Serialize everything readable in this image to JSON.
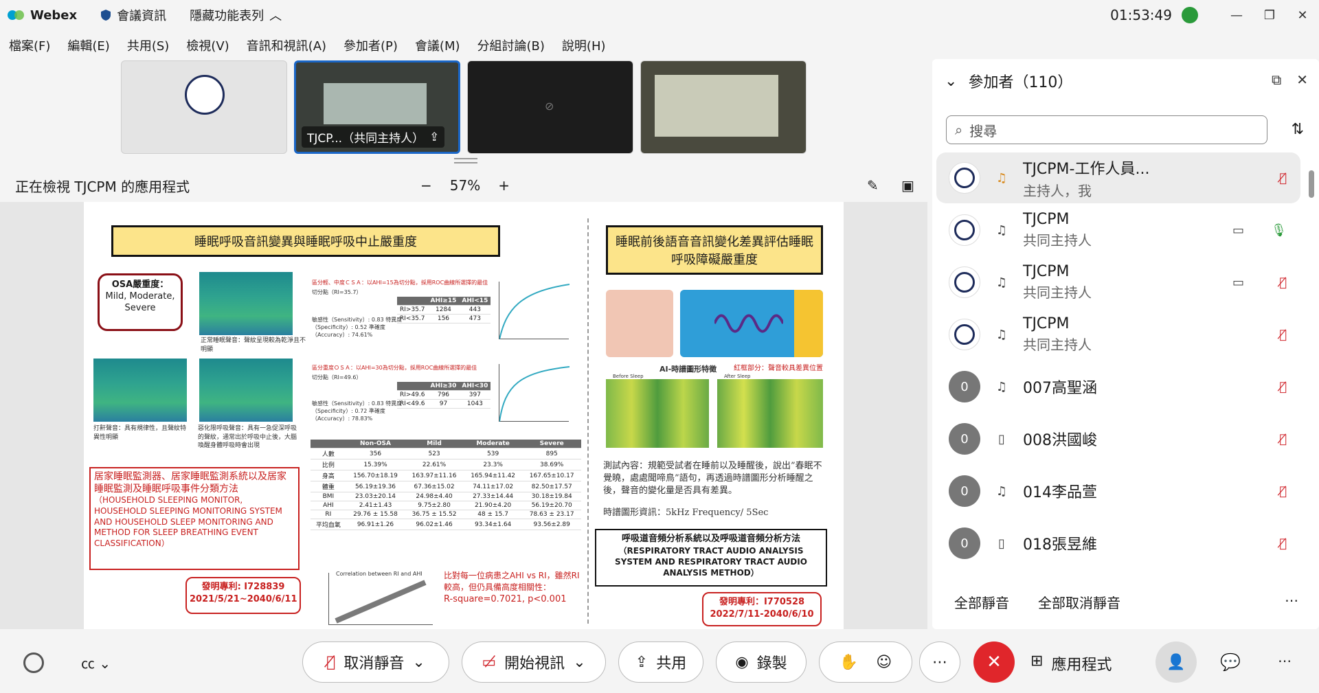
{
  "titlebar": {
    "app_name": "Webex",
    "meeting_info": "會議資訊",
    "hidden_features": "隱藏功能表列",
    "time": "01:53:49"
  },
  "menu": [
    "檔案(F)",
    "編輯(E)",
    "共用(S)",
    "檢視(V)",
    "音訊和視訊(A)",
    "參加者(P)",
    "會議(M)",
    "分組討論(B)",
    "說明(H)"
  ],
  "thumbnails": [
    {
      "label": ""
    },
    {
      "label": "TJCP...（共同主持人）"
    },
    {
      "label": ""
    },
    {
      "label": ""
    }
  ],
  "view": {
    "title": "正在檢視 TJCPM 的應用程式",
    "zoom": "57%"
  },
  "poster": {
    "left_title": "睡眠呼吸音訊變異與睡眠呼吸中止嚴重度",
    "right_title": "睡眠前後語音音訊變化差異評估睡眠呼吸障礙嚴重度",
    "osa_label": "OSA嚴重度：",
    "osa_levels": "Mild, Moderate, Severe",
    "normal_caption": "正常睡眠聲音：聲紋呈現較為乾淨且不明顯",
    "snore_caption": "打鼾聲音：具有規律性，且聲紋特異性明顯",
    "apnea_caption": "惡化限呼吸聲音：具有一急促深呼吸的聲紋，通常出於呼吸中止後，大腦喚醒身體呼吸時會出現",
    "invention_cn": "居家睡眠監測器、居家睡眠監測系統以及居家睡眠監測及睡眠呼吸事件分類方法",
    "invention_en": "（HOUSEHOLD SLEEPING MONITOR, HOUSEHOLD SLEEPING MONITORING SYSTEM AND HOUSEHOLD SLEEP MONITORING AND METHOD FOR SLEEP BREATHING EVENT CLASSIFICATION）",
    "patent1_no": "發明專利: I728839",
    "patent1_date": "2021/5/21~2040/6/11",
    "cut1_title": "區分輕、中度ＣＳＡ：以AHI=15為切分點，採用ROC曲線所選擇的最佳",
    "cut1_point": "切分點（RI=35.7）",
    "cut1_stats": "敏感性（Sensitivity）: 0.83  特異度（Specificity）: 0.52  準確度（Accuracy）: 74.61%",
    "cut2_title": "區分重度ＯＳＡ：以AHI=30為切分點，採用ROC曲線所選擇的最佳",
    "cut2_point": "切分點（RI=49.6）",
    "cut2_stats": "敏感性（Sensitivity）: 0.83  特異度（Specificity）: 0.72  準確度（Accuracy）: 78.83%",
    "compare_text": "比對每一位病患之AHI vs RI，雖然RI較高，但仍具備高度相關性：",
    "rsquare": "R-square=0.7021, p<0.001",
    "scatter_title": "Correlation between RI and AHI",
    "ai_title": "AI-時譜圖形特徵",
    "ai_red": "紅框部分：聲音較具差異位置",
    "before_sleep": "Before Sleep",
    "after_sleep": "After Sleep",
    "test_content": "測試內容：規範受試者在睡前以及睡醒後，說出”春眠不覺曉，處處聞啼鳥”語句，再透過時譜圖形分析睡醒之後，聲音的變化量是否具有差異。",
    "spectro_info": "時譜圖形資訊：5kHz Frequency/ 5Sec",
    "method_cn": "呼吸道音頻分析系統以及呼吸道音頻分析方法",
    "method_en": "（RESPIRATORY TRACT AUDIO ANALYSIS SYSTEM AND RESPIRATORY TRACT AUDIO ANALYSIS METHOD）",
    "patent2_no": "發明專利：I770528",
    "patent2_date": "2022/7/11-2040/6/10",
    "stats_headers": [
      "",
      "Non-OSA",
      "Mild",
      "Moderate",
      "Severe"
    ],
    "stats_rows": [
      [
        "人數",
        "356",
        "523",
        "539",
        "895"
      ],
      [
        "比例",
        "15.39%",
        "22.61%",
        "23.3%",
        "38.69%"
      ],
      [
        "身高",
        "156.70±18.19",
        "163.97±11.16",
        "165.94±11.42",
        "167.65±10.17"
      ],
      [
        "體重",
        "56.19±19.36",
        "67.36±15.02",
        "74.11±17.02",
        "82.50±17.57"
      ],
      [
        "BMI",
        "23.03±20.14",
        "24.98±4.40",
        "27.33±14.44",
        "30.18±19.84"
      ],
      [
        "AHI",
        "2.41±1.43",
        "9.75±2.80",
        "21.90±4.20",
        "56.19±20.70"
      ],
      [
        "RI",
        "29.76 ± 15.58",
        "36.75 ± 15.52",
        "48 ± 15.7",
        "78.63 ± 23.17"
      ],
      [
        "平均血氧",
        "96.91±1.26",
        "96.02±1.46",
        "93.34±1.64",
        "93.56±2.89"
      ]
    ],
    "ct1": [
      [
        "",
        "AHI≥15",
        "AHI<15"
      ],
      [
        "RI>35.7",
        "1284",
        "443"
      ],
      [
        "RI<35.7",
        "156",
        "473"
      ]
    ],
    "ct2": [
      [
        "",
        "AHI≥30",
        "AHI<30"
      ],
      [
        "RI>49.6",
        "796",
        "397"
      ],
      [
        "RI<49.6",
        "97",
        "1043"
      ]
    ]
  },
  "participants": {
    "title": "參加者（110）",
    "search_placeholder": "搜尋",
    "list": [
      {
        "name": "TJCPM-工作人員...",
        "role": "主持人，我",
        "avatar": "",
        "mic": "muted"
      },
      {
        "name": "TJCPM",
        "role": "共同主持人",
        "avatar": "",
        "mic": "on"
      },
      {
        "name": "TJCPM",
        "role": "共同主持人",
        "avatar": "",
        "mic": "muted"
      },
      {
        "name": "TJCPM",
        "role": "共同主持人",
        "avatar": "",
        "mic": "muted"
      },
      {
        "name": "007高聖涵",
        "role": "",
        "avatar": "0",
        "mic": "muted"
      },
      {
        "name": "008洪國峻",
        "role": "",
        "avatar": "0",
        "mic": "muted"
      },
      {
        "name": "014李品萱",
        "role": "",
        "avatar": "0",
        "mic": "muted"
      },
      {
        "name": "018張昱維",
        "role": "",
        "avatar": "0",
        "mic": "muted"
      }
    ],
    "mute_all": "全部靜音",
    "unmute_all": "全部取消靜音"
  },
  "controls": {
    "unmute": "取消靜音",
    "start_video": "開始視訊",
    "share": "共用",
    "record": "錄製",
    "apps": "應用程式"
  },
  "colors": {
    "accent": "#1a66c6",
    "danger": "#e0262b",
    "poster_yellow": "#fce48a",
    "poster_red": "#c8201f"
  }
}
